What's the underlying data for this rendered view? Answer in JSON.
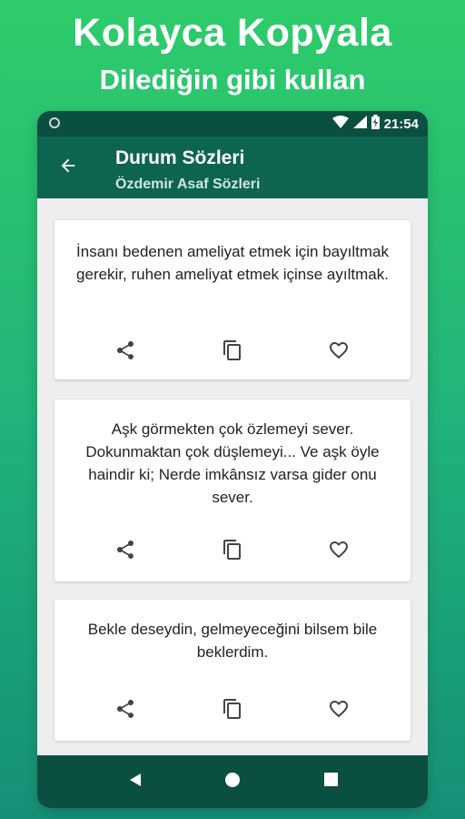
{
  "promo": {
    "title": "Kolayca Kopyala",
    "subtitle": "Dilediğin gibi kullan"
  },
  "status_bar": {
    "time": "21:54",
    "icons": [
      "circle-icon",
      "wifi-icon",
      "signal-icon",
      "battery-icon"
    ]
  },
  "app_bar": {
    "title": "Durum Sözleri",
    "subtitle": "Özdemir Asaf Sözleri",
    "back_icon": "arrow-back-icon"
  },
  "quotes": [
    {
      "text": "İnsanı bedenen ameliyat etmek için bayıltmak gerekir, ruhen ameliyat etmek içinse ayıltmak."
    },
    {
      "text": "Aşk görmekten çok özlemeyi sever. Dokunmaktan çok düşlemeyi... Ve aşk öyle haindir ki; Nerde imkânsız varsa gider onu sever."
    },
    {
      "text": "Bekle deseydin, gelmeyeceğini bilsem bile beklerdim."
    }
  ],
  "card_actions": [
    "share-icon",
    "copy-icon",
    "favorite-icon"
  ],
  "nav_bar": [
    "back-triangle-icon",
    "home-circle-icon",
    "recents-square-icon"
  ],
  "colors": {
    "background_gradient_top": "#2ecc6a",
    "background_gradient_bottom": "#159078",
    "status_bar": "#0b4f40",
    "app_bar": "#0d6450",
    "content_bg": "#eeeeee",
    "card_bg": "#ffffff",
    "icon_gray": "#444444"
  }
}
